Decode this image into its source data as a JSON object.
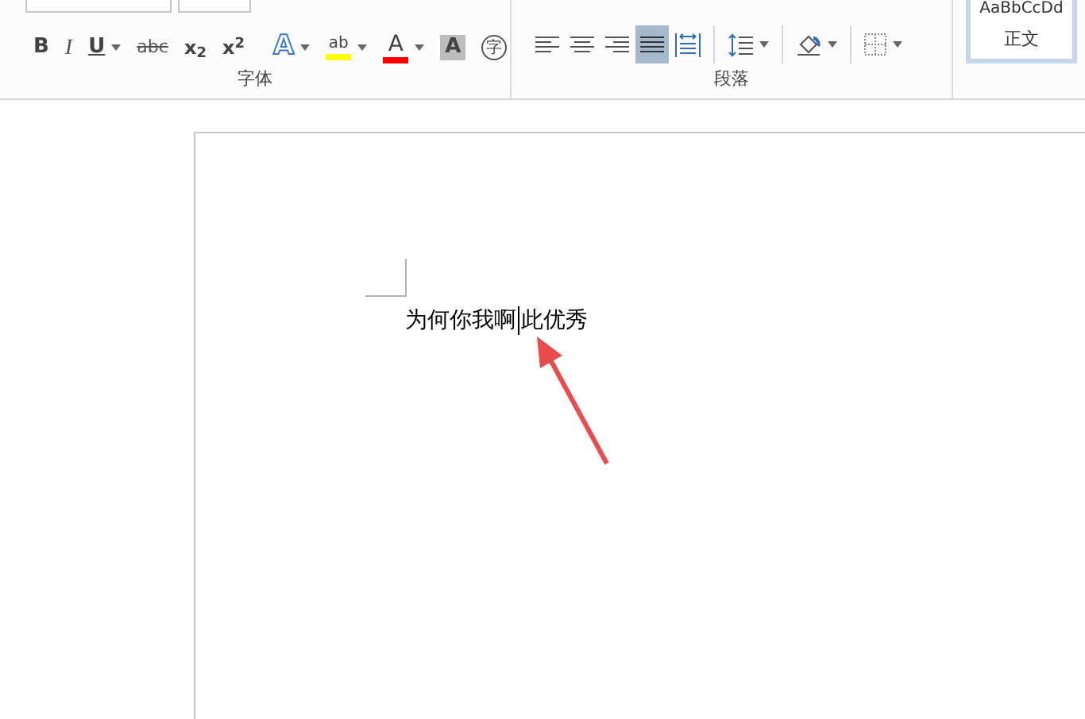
{
  "ribbon": {
    "font_group": {
      "label": "字体",
      "buttons": [
        {
          "kind": "bold",
          "label": "B",
          "dropdown": false
        },
        {
          "kind": "italic",
          "label": "I",
          "dropdown": false
        },
        {
          "kind": "underline",
          "label": "U",
          "dropdown": true
        },
        {
          "kind": "strike",
          "label": "abc",
          "dropdown": false
        },
        {
          "kind": "script",
          "label": "x$_{2}$",
          "dropdown": false
        },
        {
          "kind": "script",
          "label": "x$^{2}$",
          "dropdown": false
        },
        {
          "kind": "sep"
        },
        {
          "kind": "effect",
          "label": "A",
          "dropdown": true
        },
        {
          "kind": "highlight",
          "label": "ab",
          "dropdown": true
        },
        {
          "kind": "color",
          "label": "A",
          "dropdown": true
        },
        {
          "kind": "shade",
          "label": "A",
          "dropdown": false
        },
        {
          "kind": "circle",
          "label": "字",
          "dropdown": false
        }
      ]
    },
    "paragraph_group": {
      "label": "段落",
      "buttons": [
        {
          "kind": "align-left",
          "selected": false
        },
        {
          "kind": "align-center",
          "selected": false
        },
        {
          "kind": "align-right",
          "selected": false
        },
        {
          "kind": "justify",
          "selected": true
        },
        {
          "kind": "distribute",
          "selected": false
        },
        {
          "kind": "line-spacing",
          "selected": false
        },
        {
          "kind": "shading",
          "selected": false
        },
        {
          "kind": "borders",
          "selected": false
        }
      ]
    },
    "styles": {
      "preview": "AaBbCcDd",
      "name": "正文"
    }
  },
  "document": {
    "text_before_cursor": "为何你我啊",
    "text_after_cursor": "此优秀"
  }
}
